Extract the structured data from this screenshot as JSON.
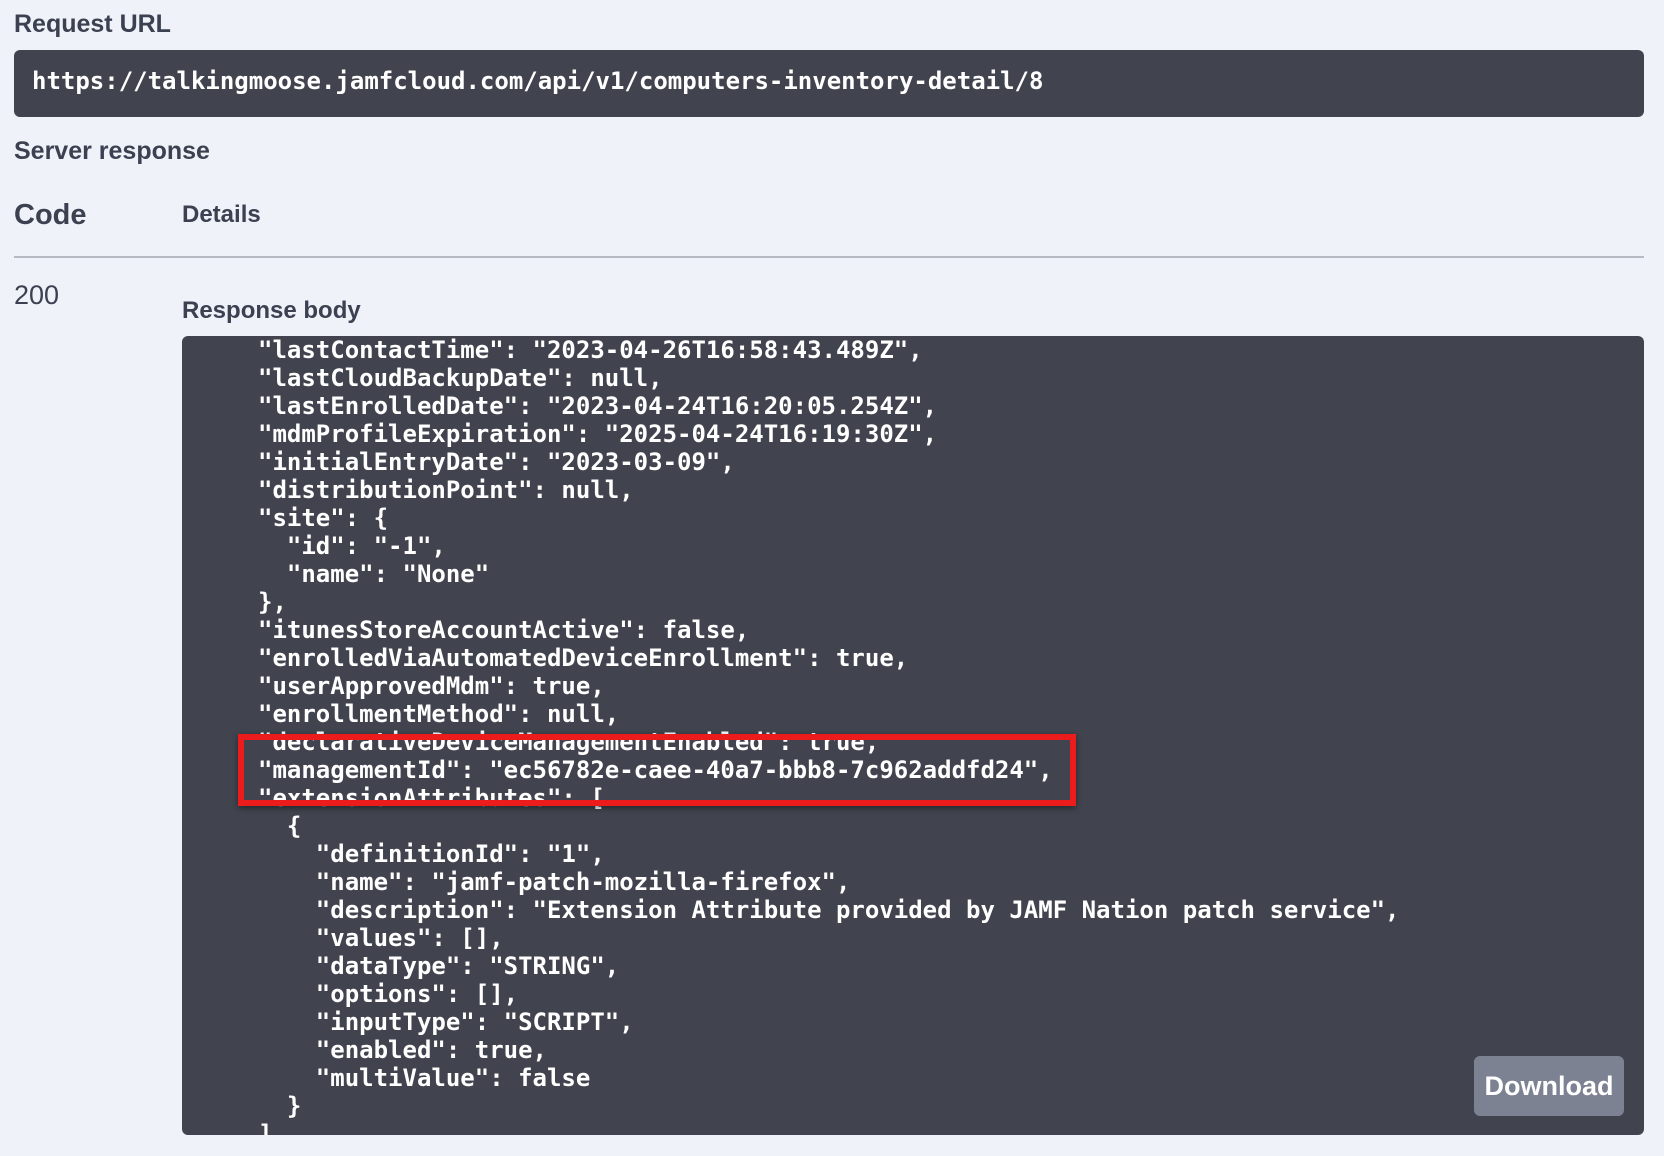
{
  "request": {
    "label": "Request URL",
    "url": "https://talkingmoose.jamfcloud.com/api/v1/computers-inventory-detail/8"
  },
  "server_response": {
    "label": "Server response",
    "code_header": "Code",
    "details_header": "Details",
    "status_code": "200",
    "response_body_label": "Response body",
    "download_label": "Download"
  },
  "response_body": {
    "lines": [
      "\"lastContactTime\": \"2023-04-26T16:58:43.489Z\",",
      "\"lastCloudBackupDate\": null,",
      "\"lastEnrolledDate\": \"2023-04-24T16:20:05.254Z\",",
      "\"mdmProfileExpiration\": \"2025-04-24T16:19:30Z\",",
      "\"initialEntryDate\": \"2023-03-09\",",
      "\"distributionPoint\": null,",
      "\"site\": {",
      "  \"id\": \"-1\",",
      "  \"name\": \"None\"",
      "},",
      "\"itunesStoreAccountActive\": false,",
      "\"enrolledViaAutomatedDeviceEnrollment\": true,",
      "\"userApprovedMdm\": true,",
      "\"enrollmentMethod\": null,",
      "\"declarativeDeviceManagementEnabled\": true,",
      "\"managementId\": \"ec56782e-caee-40a7-bbb8-7c962addfd24\",",
      "\"extensionAttributes\": [",
      "  {",
      "    \"definitionId\": \"1\",",
      "    \"name\": \"jamf-patch-mozilla-firefox\",",
      "    \"description\": \"Extension Attribute provided by JAMF Nation patch service\",",
      "    \"values\": [],",
      "    \"dataType\": \"STRING\",",
      "    \"options\": [],",
      "    \"inputType\": \"SCRIPT\",",
      "    \"enabled\": true,",
      "    \"multiValue\": false",
      "  }",
      "]"
    ],
    "highlighted_line_index": 15
  },
  "colors": {
    "page_background": "#f0f2f9",
    "code_background": "#41444e",
    "highlight_border": "#ec1c1c",
    "download_button": "#7d8293"
  }
}
